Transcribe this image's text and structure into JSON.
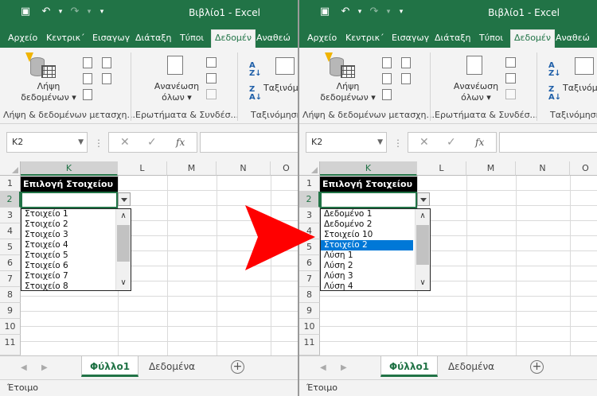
{
  "window": {
    "title": "Βιβλίο1  -  Excel",
    "quick_access": {
      "save_icon": "save-icon",
      "undo_icon": "undo-icon",
      "redo_icon": "redo-icon",
      "customize_icon": "chevron-down-icon"
    }
  },
  "ribbon": {
    "tabs": [
      "Αρχείο",
      "Κεντρικ΄",
      "Εισαγωγ",
      "Διάταξη",
      "Τύποι",
      "Δεδομέν",
      "Αναθεώ"
    ],
    "active_tab": "Δεδομέν",
    "groups": {
      "get_data": {
        "button_line1": "Λήψη",
        "button_line2": "δεδομένων",
        "label": "Λήψη & δεδομένων μετασχη..."
      },
      "queries": {
        "button_line1": "Ανανέωση",
        "button_line2": "όλων",
        "label": "Ερωτήματα & Συνδέσ..."
      },
      "sort": {
        "button": "Ταξινόμ",
        "button_right": "Ταξινόμι",
        "label": "Ταξινόμηση"
      }
    }
  },
  "formula_bar": {
    "name_box": "K2",
    "cancel_icon": "close-icon",
    "enter_icon": "check-icon",
    "fx": "fx",
    "value": ""
  },
  "grid": {
    "columns": [
      "K",
      "L",
      "M",
      "N",
      "O"
    ],
    "rows": [
      "1",
      "2",
      "3",
      "4",
      "5",
      "6",
      "7",
      "8",
      "9",
      "10",
      "11"
    ],
    "header_cell": "Επιλογή Στοιχείου",
    "active_cell": "K2"
  },
  "left_dropdown": {
    "items": [
      "Στοιχείο 1",
      "Στοιχείο 2",
      "Στοιχείο 3",
      "Στοιχείο 4",
      "Στοιχείο 5",
      "Στοιχείο 6",
      "Στοιχείο 7",
      "Στοιχείο 8"
    ]
  },
  "right_dropdown": {
    "items": [
      "Δεδομένο 1",
      "Δεδομένο 2",
      "Στοιχείο 10",
      "Στοιχείο 2",
      "Λύση 1",
      "Λύση 2",
      "Λύση 3",
      "Λύση 4"
    ],
    "highlighted": "Στοιχείο 2"
  },
  "sheets": {
    "tabs": [
      "Φύλλο1",
      "Δεδομένα"
    ],
    "active": "Φύλλο1"
  },
  "status": {
    "text": "Έτοιμο"
  },
  "colors": {
    "excel_green": "#217346",
    "selection_blue": "#0078d7",
    "arrow_red": "#ff0000"
  }
}
